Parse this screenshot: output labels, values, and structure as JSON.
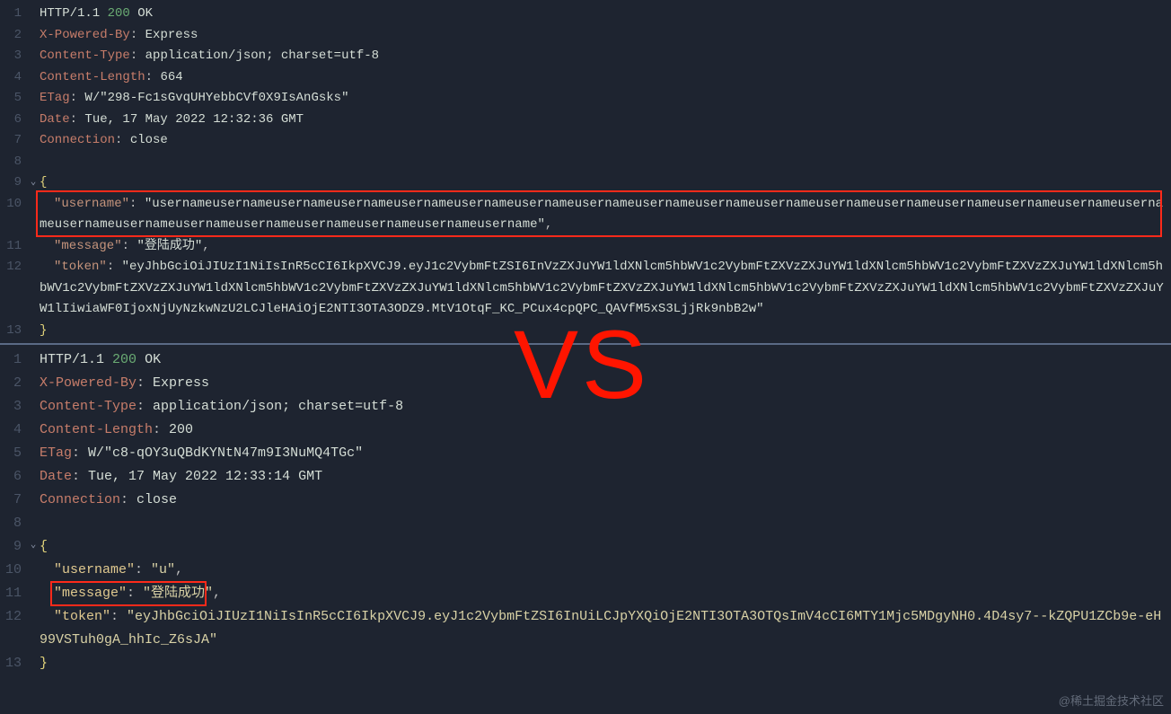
{
  "top": {
    "lines": [
      "1",
      "2",
      "3",
      "4",
      "5",
      "6",
      "7",
      "8",
      "9",
      "10",
      "11",
      "12",
      "13"
    ],
    "http": {
      "proto": "HTTP/1.1",
      "code": "200",
      "reason": "OK"
    },
    "headers": {
      "x_powered_by": {
        "k": "X-Powered-By",
        "v": "Express"
      },
      "content_type": {
        "k": "Content-Type",
        "v": "application/json; charset=utf-8"
      },
      "content_len": {
        "k": "Content-Length",
        "v": "664"
      },
      "etag": {
        "k": "ETag",
        "v": "W/\"298-Fc1sGvqUHYebbCVf0X9IsAnGsks\""
      },
      "date": {
        "k": "Date",
        "v": "Tue, 17 May 2022 12:32:36 GMT"
      },
      "connection": {
        "k": "Connection",
        "v": "close"
      }
    },
    "body": {
      "open": "{",
      "username_k": "\"username\"",
      "username_v": "\"usernameusernameusernameusernameusernameusernameusernameusernameusernameusernameusernameusernameusernameusernameusernameusernameusernameusernameusernameusernameusernameusernameusernameusernameusername\"",
      "message_k": "\"message\"",
      "message_v": "\"登陆成功\"",
      "token_k": "\"token\"",
      "token_v": "\"eyJhbGciOiJIUzI1NiIsInR5cCI6IkpXVCJ9.eyJ1c2VybmFtZSI6InVzZXJuYW1ldXNlcm5hbWV1c2VybmFtZXVzZXJuYW1ldXNlcm5hbWV1c2VybmFtZXVzZXJuYW1ldXNlcm5hbWV1c2VybmFtZXVzZXJuYW1ldXNlcm5hbWV1c2VybmFtZXVzZXJuYW1ldXNlcm5hbWV1c2VybmFtZXVzZXJuYW1ldXNlcm5hbWV1c2VybmFtZXVzZXJuYW1ldXNlcm5hbWV1c2VybmFtZXVzZXJuYW1lIiwiaWF0IjoxNjUyNzkwNzU2LCJleHAiOjE2NTI3OTA3ODZ9.MtV1OtqF_KC_PCux4cpQPC_QAVfM5xS3LjjRk9nbB2w\"",
      "close": "}"
    }
  },
  "bottom": {
    "lines": [
      "1",
      "2",
      "3",
      "4",
      "5",
      "6",
      "7",
      "8",
      "9",
      "10",
      "11",
      "12",
      "13"
    ],
    "http": {
      "proto": "HTTP/1.1",
      "code": "200",
      "reason": "OK"
    },
    "headers": {
      "x_powered_by": {
        "k": "X-Powered-By",
        "v": "Express"
      },
      "content_type": {
        "k": "Content-Type",
        "v": "application/json; charset=utf-8"
      },
      "content_len": {
        "k": "Content-Length",
        "v": "200"
      },
      "etag": {
        "k": "ETag",
        "v": "W/\"c8-qOY3uQBdKYNtN47m9I3NuMQ4TGc\""
      },
      "date": {
        "k": "Date",
        "v": "Tue, 17 May 2022 12:33:14 GMT"
      },
      "connection": {
        "k": "Connection",
        "v": "close"
      }
    },
    "body": {
      "open": "{",
      "username_k": "\"username\"",
      "username_v": "\"u\"",
      "message_k": "\"message\"",
      "message_v": "\"登陆成功\"",
      "token_k": "\"token\"",
      "token_v": "\"eyJhbGciOiJIUzI1NiIsInR5cCI6IkpXVCJ9.eyJ1c2VybmFtZSI6InUiLCJpYXQiOjE2NTI3OTA3OTQsImV4cCI6MTY1Mjc5MDgyNH0.4D4sy7--kZQPU1ZCb9e-eH99VSTuh0gA_hhIc_Z6sJA\"",
      "close": "}"
    }
  },
  "overlay": {
    "vs": "VS",
    "watermark": "@稀土掘金技术社区"
  },
  "glyph": {
    "fold": "⌄"
  }
}
